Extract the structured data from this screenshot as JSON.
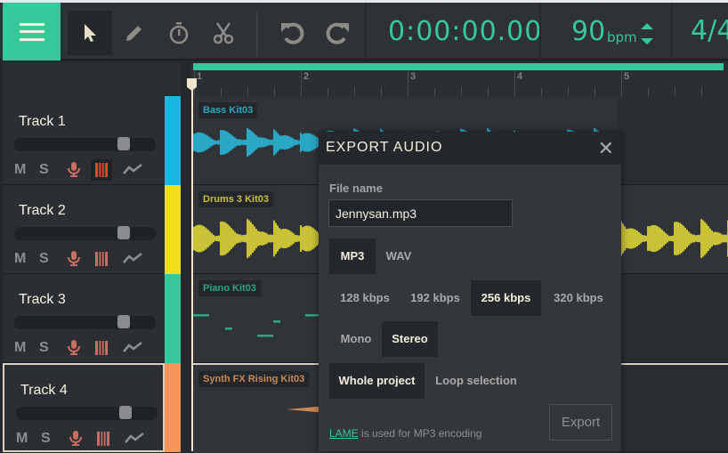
{
  "toolbar": {
    "tools": [
      "menu-icon",
      "pointer-icon",
      "pencil-icon",
      "stopwatch-icon",
      "scissors-icon",
      "undo-icon",
      "redo-icon"
    ],
    "time": "0:00:00.00",
    "bpm": "90",
    "bpm_unit": "bpm",
    "time_signature": "4/4"
  },
  "ruler": {
    "bars": [
      "1",
      "2",
      "3",
      "4",
      "5"
    ]
  },
  "tracks": [
    {
      "name": "Track 1",
      "mute": "M",
      "solo": "S",
      "color": "#19b8e0",
      "clip": "Bass Kit03",
      "clip_color": "#2aa7c4",
      "volume": 0.8,
      "piano_active": true
    },
    {
      "name": "Track 2",
      "mute": "M",
      "solo": "S",
      "color": "#f0df1c",
      "clip": "Drums 3 Kit03",
      "clip_color": "#c9c236",
      "volume": 0.8
    },
    {
      "name": "Track 3",
      "mute": "M",
      "solo": "S",
      "color": "#34c89a",
      "clip": "Piano Kit03",
      "clip_color": "#2aa882",
      "volume": 0.8
    },
    {
      "name": "Track 4",
      "mute": "M",
      "solo": "S",
      "color": "#f5955c",
      "clip": "Synth FX Rising Kit03",
      "clip_color": "#c98957",
      "volume": 0.8,
      "selected": true
    }
  ],
  "dialog": {
    "title": "EXPORT AUDIO",
    "file_label": "File name",
    "file_value": "Jennysan.mp3",
    "formats": [
      "MP3",
      "WAV"
    ],
    "bitrates": [
      "128 kbps",
      "192 kbps",
      "256 kbps",
      "320 kbps"
    ],
    "channels": [
      "Mono",
      "Stereo"
    ],
    "ranges": [
      "Whole project",
      "Loop selection"
    ],
    "selected": {
      "format": "MP3",
      "bitrate": "256 kbps",
      "channels": "Stereo",
      "range": "Whole project"
    },
    "export_label": "Export",
    "lame_link": "LAME",
    "lame_text": " is used for MP3 encoding"
  },
  "colors": {
    "accent": "#34c89a"
  }
}
